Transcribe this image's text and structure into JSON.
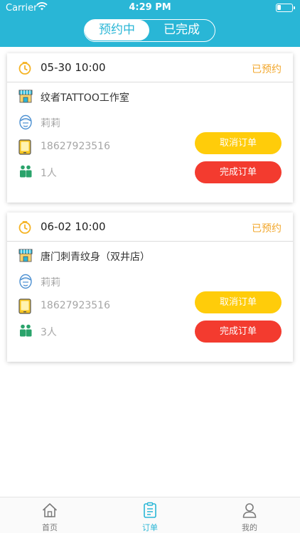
{
  "status_bar": {
    "carrier": "Carrier",
    "time": "4:29 PM"
  },
  "tabs": {
    "active_label": "预约中",
    "inactive_label": "已完成"
  },
  "orders": [
    {
      "datetime": "05-30 10:00",
      "status": "已预约",
      "shop": "纹者TATTOO工作室",
      "artist": "莉莉",
      "phone": "18627923516",
      "people": "1人",
      "cancel_label": "取消订单",
      "complete_label": "完成订单"
    },
    {
      "datetime": "06-02 10:00",
      "status": "已预约",
      "shop": "唐门刺青纹身（双井店）",
      "artist": "莉莉",
      "phone": "18627923516",
      "people": "3人",
      "cancel_label": "取消订单",
      "complete_label": "完成订单"
    }
  ],
  "tab_bar": {
    "home": "首页",
    "orders": "订单",
    "mine": "我的",
    "active_color": "#29b6d6",
    "inactive_color": "#7a7a7a"
  },
  "colors": {
    "header": "#29b6d6",
    "status_text": "#f2a72c",
    "cancel_button": "#ffcc0a",
    "complete_button": "#f33b2f"
  }
}
